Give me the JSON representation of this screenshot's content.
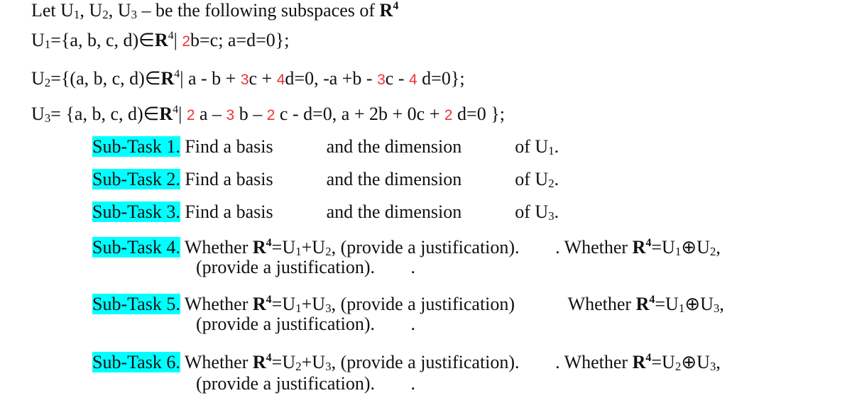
{
  "intro": {
    "text_before": "Let U",
    "u1": "1",
    "sep1": ", U",
    "u2": "2",
    "sep2": ", U",
    "u3": "3",
    "text_after": " – be the following subspaces of ",
    "field": "R",
    "field_exp": "4"
  },
  "U1": {
    "name": "U",
    "sub": "1",
    "prefix": "={a, b, c, d)∈",
    "field": "R",
    "field_exp": "4",
    "bar": "| ",
    "coef1": "2",
    "rest": "b=c; a=d=0};"
  },
  "U2": {
    "name": "U",
    "sub": "2",
    "prefix": "={(a, b, c, d)∈",
    "field": "R",
    "field_exp": "4",
    "t1": "| a - b + ",
    "c1": "3",
    "t2": "c + ",
    "c2": "4",
    "t3": "d=0, -a +b - ",
    "c3": "3",
    "t4": "c - ",
    "c4": "4",
    "t5": " d=0};"
  },
  "U3": {
    "name": "U",
    "sub": "3",
    "prefix": "= {a, b, c, d)∈",
    "field": "R",
    "field_exp": "4",
    "t1": "| ",
    "c1": "2",
    "t2": " a – ",
    "c2": "3",
    "t3": " b – ",
    "c3": "2",
    "t4": " c - d=0, a + 2b + 0c + ",
    "c4": "2",
    "t5": " d=0 };"
  },
  "tasks": [
    {
      "label": "Sub-Task 1.",
      "t1": " Find a basis ",
      "t2": " and the dimension ",
      "t3": " of U",
      "sub": "1",
      "end": "."
    },
    {
      "label": "Sub-Task 2.",
      "t1": " Find a basis ",
      "t2": " and the dimension ",
      "t3": " of U",
      "sub": "2",
      "end": "."
    },
    {
      "label": "Sub-Task 3.",
      "t1": " Find a basis ",
      "t2": " and the dimension ",
      "t3": " of U",
      "sub": "3",
      "end": "."
    },
    {
      "label": "Sub-Task 4.",
      "w": " Whether ",
      "R": "R",
      "exp": "4",
      "eq": "=U",
      "a": "1",
      "op": "+U",
      "b": "2",
      "just": ", (provide a justification). ",
      "close": ". Whether ",
      "eq2": "=U",
      "a2": "1",
      "op2": "⊕U",
      "b2": "2",
      "comma": ",",
      "line2": "(provide a justification). ",
      "end2": "."
    },
    {
      "label": "Sub-Task 5.",
      "w": " Whether ",
      "R": "R",
      "exp": "4",
      "eq": "=U",
      "a": "1",
      "op": "+U",
      "b": "3",
      "just": ", (provide a justification) ",
      "close": " Whether ",
      "eq2": "=U",
      "a2": "1",
      "op2": "⊕U",
      "b2": "3",
      "comma": ",",
      "line2": "(provide a justification). ",
      "end2": "."
    },
    {
      "label": "Sub-Task 6.",
      "w": " Whether ",
      "R": "R",
      "exp": "4",
      "eq": "=U",
      "a": "2",
      "op": "+U",
      "b": "3",
      "just": ", (provide a justification). ",
      "close": ". Whether ",
      "eq2": "=U",
      "a2": "2",
      "op2": "⊕U",
      "b2": "3",
      "comma": ",",
      "line2": "(provide a justification). ",
      "end2": "."
    }
  ]
}
